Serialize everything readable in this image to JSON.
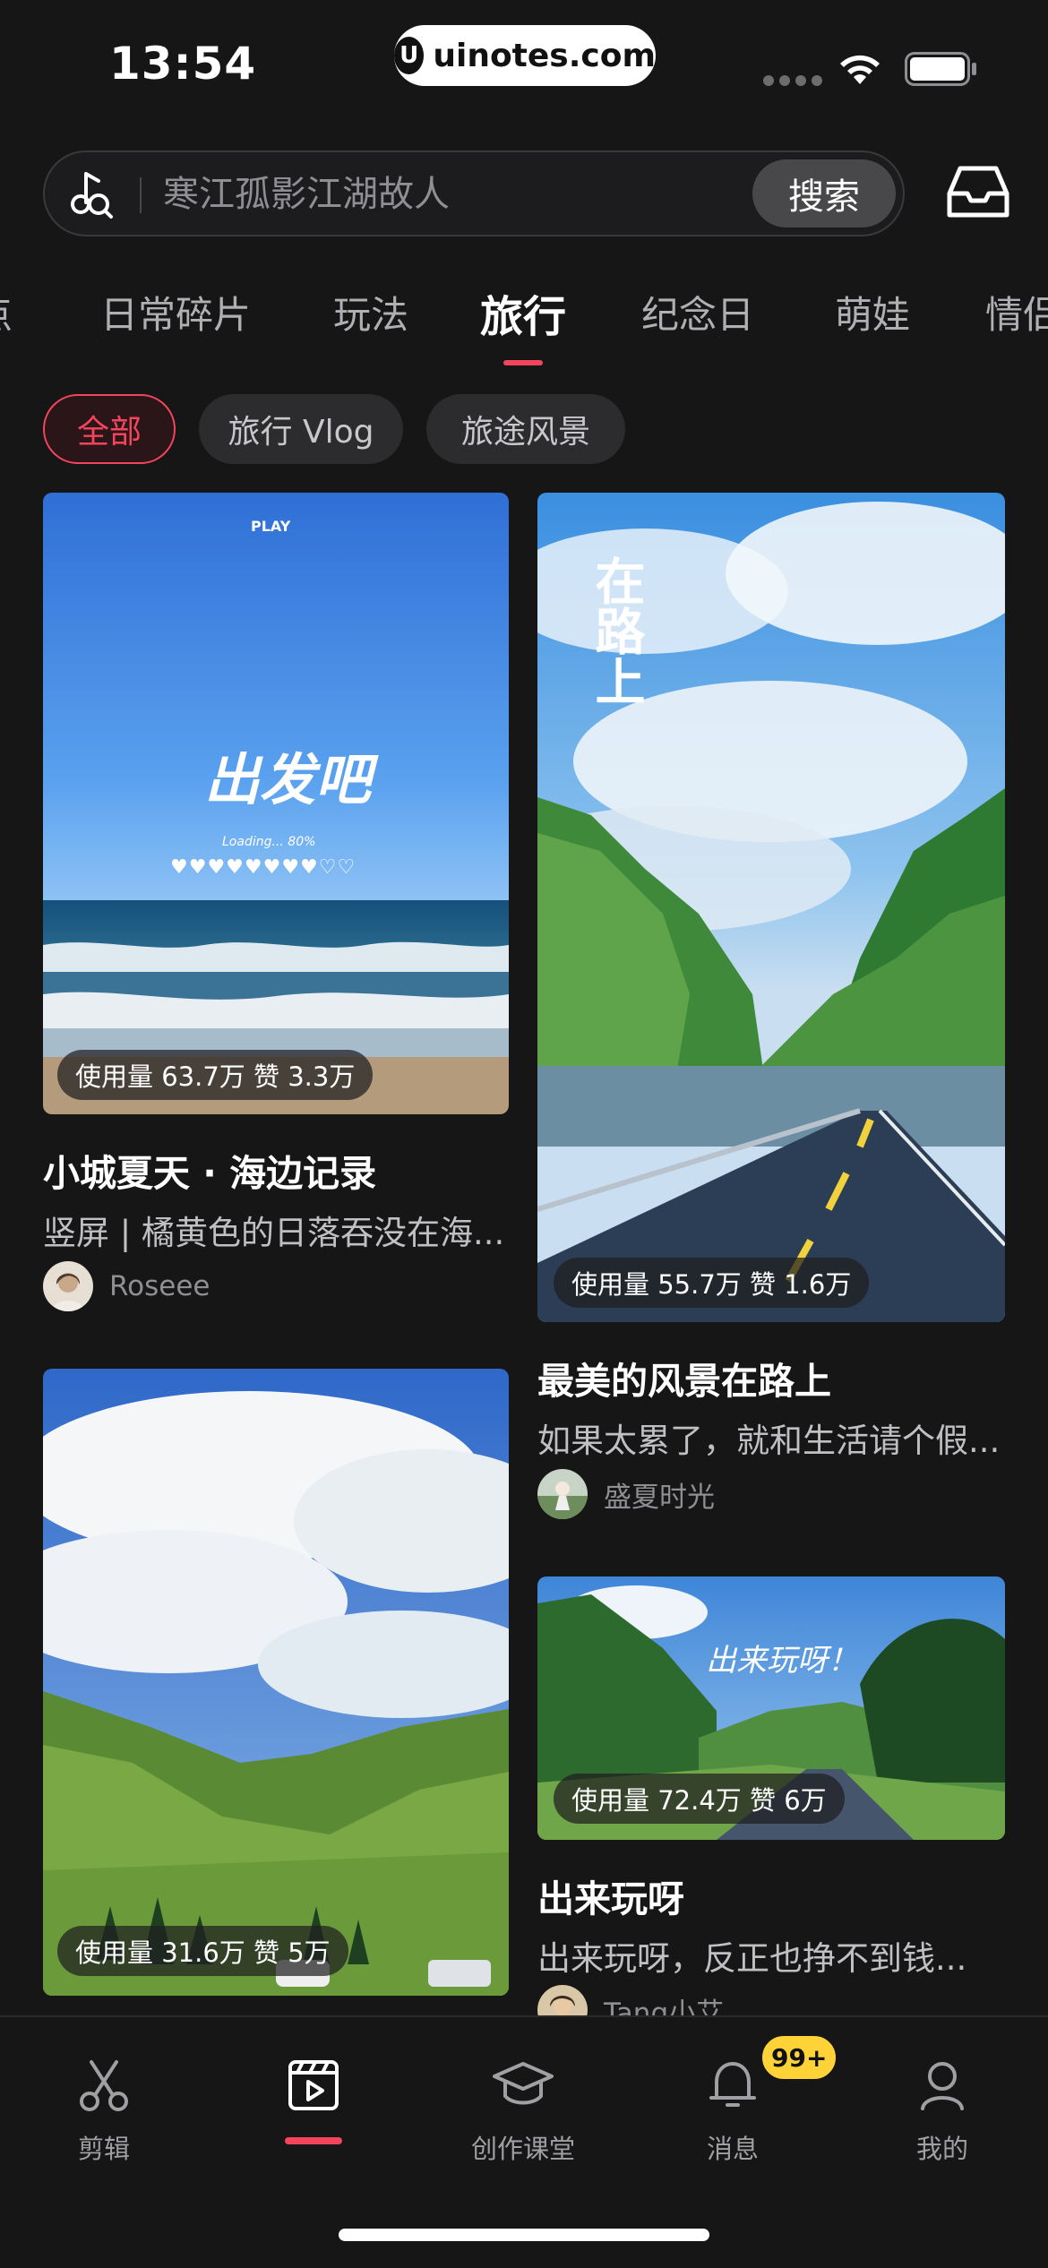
{
  "status": {
    "time": "13:54",
    "watermark": "uinotes.com",
    "watermark_logo": "U"
  },
  "search": {
    "placeholder": "寒江孤影江湖故人",
    "button": "搜索"
  },
  "tabs": [
    {
      "label": "点"
    },
    {
      "label": "日常碎片"
    },
    {
      "label": "玩法"
    },
    {
      "label": "旅行"
    },
    {
      "label": "纪念日"
    },
    {
      "label": "萌娃"
    },
    {
      "label": "情侣"
    }
  ],
  "active_tab": "旅行",
  "chips": [
    {
      "label": "全部"
    },
    {
      "label": "旅行 Vlog"
    },
    {
      "label": "旅途风景"
    }
  ],
  "cards": [
    {
      "overlay_text": "出发吧",
      "overlay_small": "PLAY",
      "overlay_loading": "Loading... 80%",
      "usage": "使用量 63.7万 赞 3.3万",
      "title": "小城夏天 · 海边记录",
      "desc": "竖屏 | 橘黄色的日落吞没在海...",
      "author": "Roseee"
    },
    {
      "overlay_text": "在路上",
      "usage": "使用量 55.7万 赞 1.6万",
      "title": "最美的风景在路上",
      "desc": "如果太累了，就和生活请个假...",
      "author": "盛夏时光"
    },
    {
      "usage": "使用量 31.6万 赞 5万"
    },
    {
      "overlay_text": "出来玩呀！",
      "usage": "使用量 72.4万 赞 6万",
      "title": "出来玩呀",
      "desc": "出来玩呀，反正也挣不到钱...",
      "author": "Tang小艾"
    }
  ],
  "tabbar": [
    {
      "label": "剪辑",
      "icon": "scissors-icon"
    },
    {
      "label": "",
      "icon": "template-icon"
    },
    {
      "label": "创作课堂",
      "icon": "graduation-cap-icon"
    },
    {
      "label": "消息",
      "icon": "bell-icon"
    },
    {
      "label": "我的",
      "icon": "person-icon"
    }
  ],
  "badge": "99+",
  "colors": {
    "accent": "#f5455c",
    "background": "#161617",
    "badge": "#ffd338"
  }
}
